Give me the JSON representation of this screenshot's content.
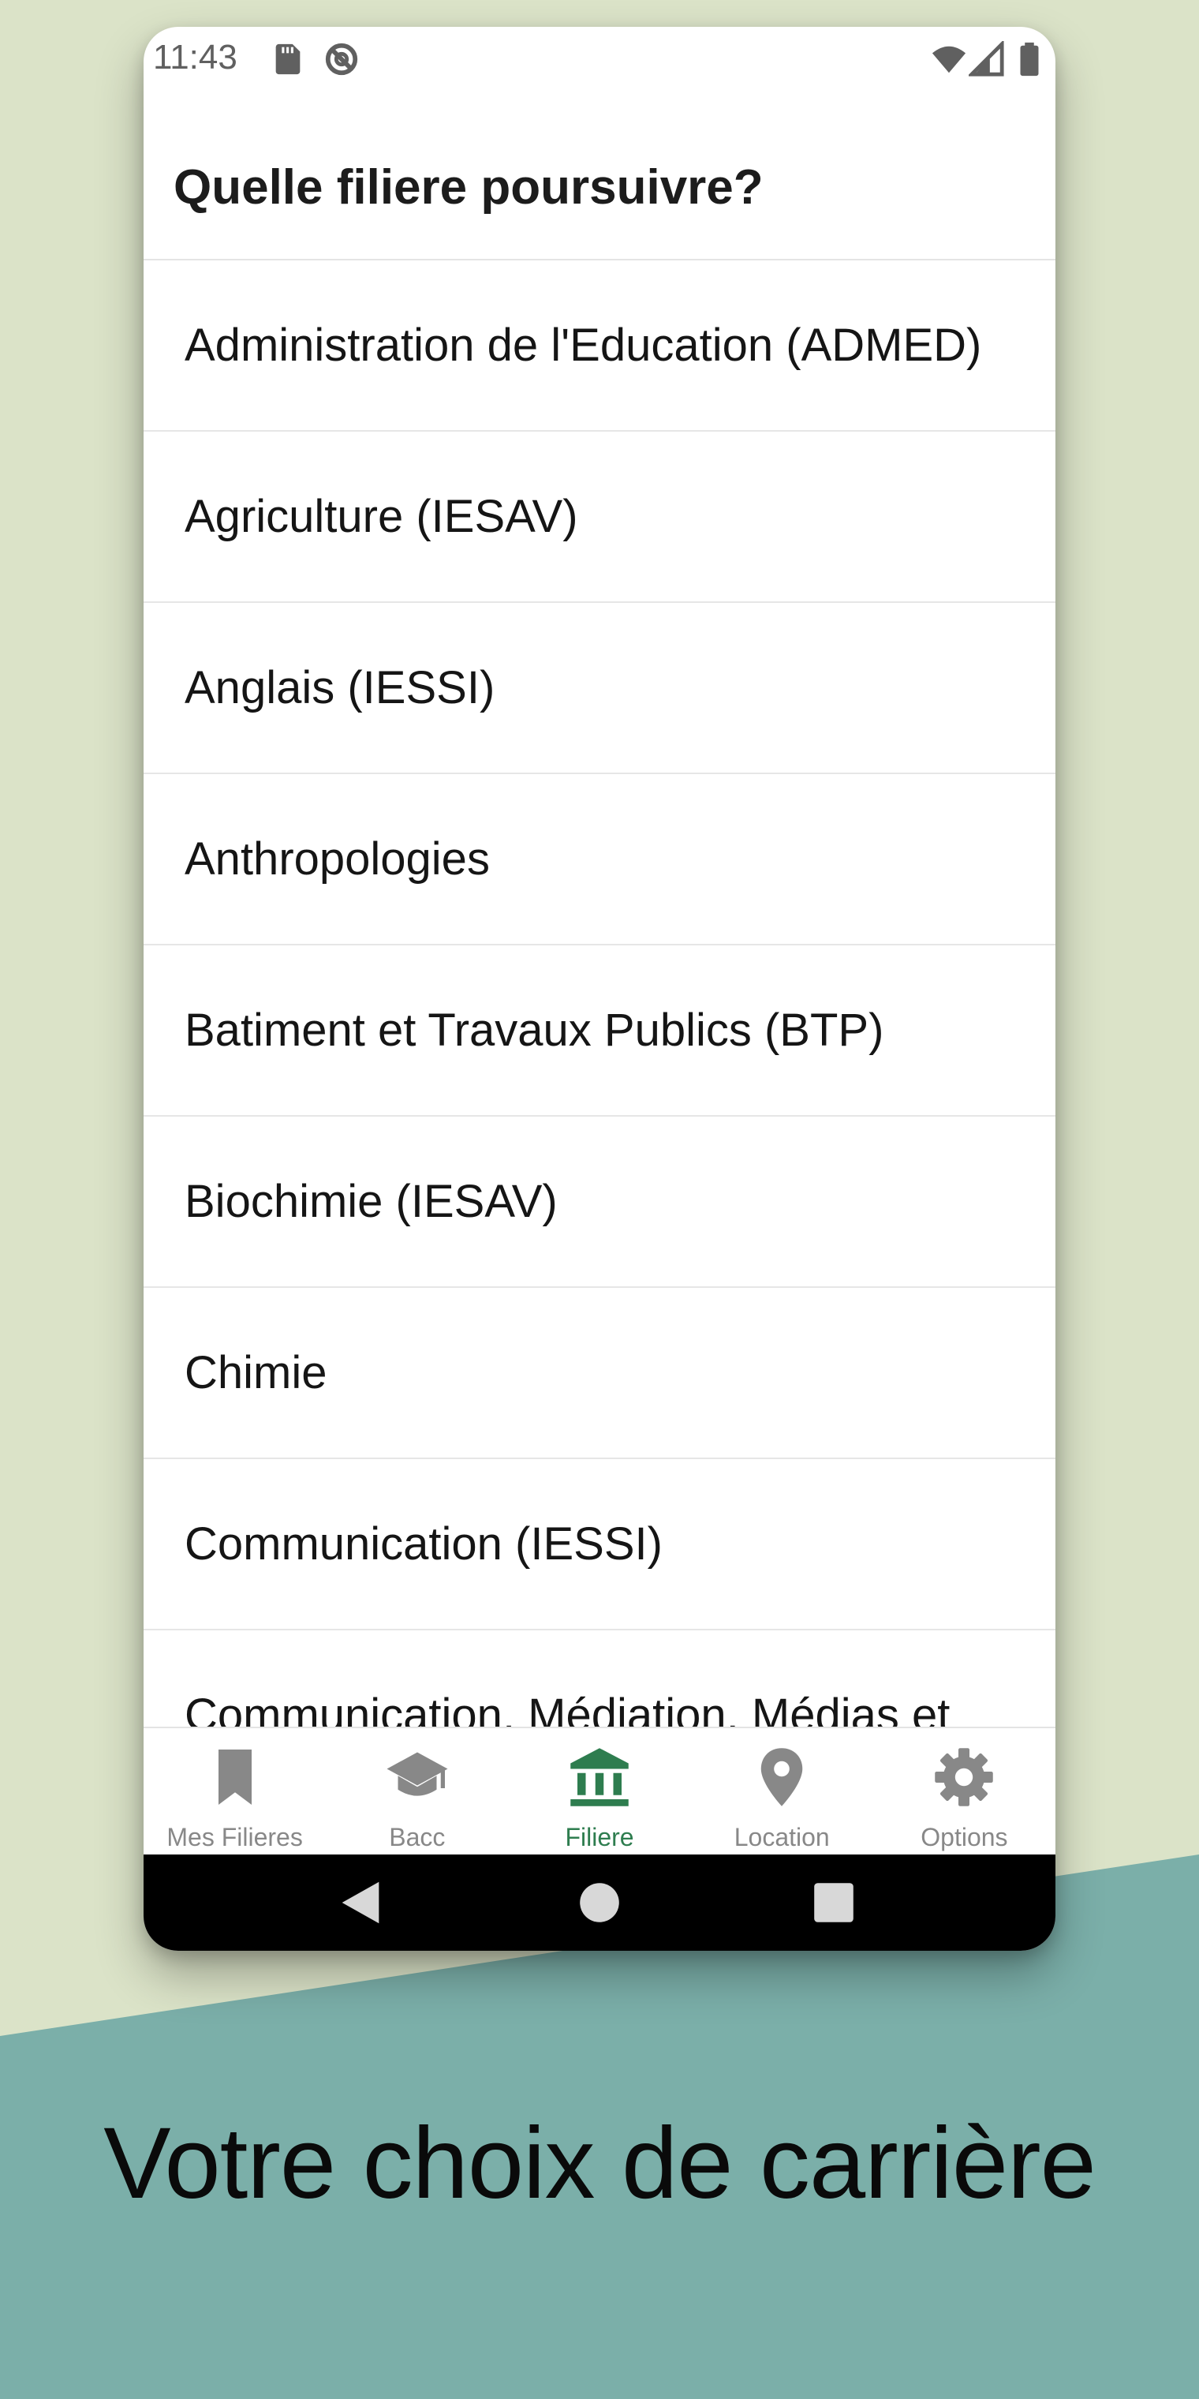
{
  "colors": {
    "page_background": "#dbe3c8",
    "teal_band": "#7bafa9",
    "accent": "#2e7d4f",
    "inactive": "#888888"
  },
  "status_bar": {
    "time": "11:43",
    "icons": [
      "sd-card-icon",
      "no-sync-icon",
      "wifi-icon",
      "signal-icon",
      "battery-icon"
    ]
  },
  "app_bar": {
    "title": "Quelle filiere poursuivre?"
  },
  "list": {
    "items": [
      "Administration de l'Education (ADMED)",
      "Agriculture (IESAV)",
      "Anglais (IESSI)",
      "Anthropologies",
      "Batiment et Travaux Publics (BTP)",
      "Biochimie (IESAV)",
      "Chimie",
      "Communication (IESSI)",
      "Communication, Médiation, Médias et"
    ]
  },
  "bottom_nav": {
    "items": [
      {
        "label": "Mes Filieres",
        "icon": "bookmark-icon",
        "active": false
      },
      {
        "label": "Bacc",
        "icon": "graduation-cap-icon",
        "active": false
      },
      {
        "label": "Filiere",
        "icon": "institution-icon",
        "active": true
      },
      {
        "label": "Location",
        "icon": "location-pin-icon",
        "active": false
      },
      {
        "label": "Options",
        "icon": "gear-icon",
        "active": false
      }
    ]
  },
  "system_nav": {
    "buttons": [
      "back-icon",
      "home-icon",
      "recents-icon"
    ]
  },
  "tagline": "Votre choix de carrière"
}
